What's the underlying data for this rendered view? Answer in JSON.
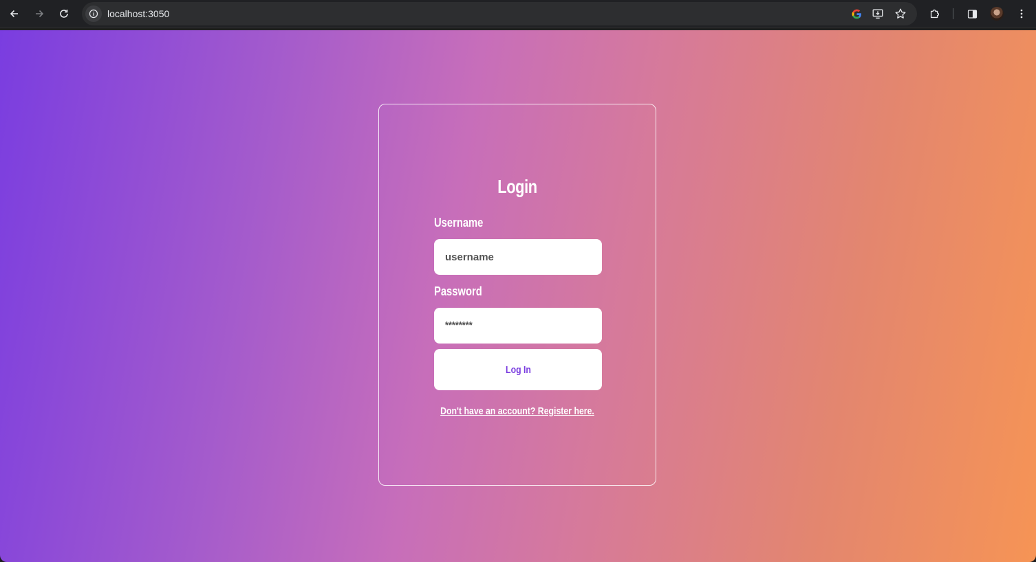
{
  "browser": {
    "url": "localhost:3050"
  },
  "login": {
    "title": "Login",
    "username_label": "Username",
    "username_placeholder": "username",
    "password_label": "Password",
    "password_value": "********",
    "submit_label": "Log In",
    "register_link": "Don't have an account? Register here."
  },
  "colors": {
    "gradient_start": "#7a3de0",
    "gradient_end": "#f69455",
    "button_text": "#7a3de0"
  }
}
